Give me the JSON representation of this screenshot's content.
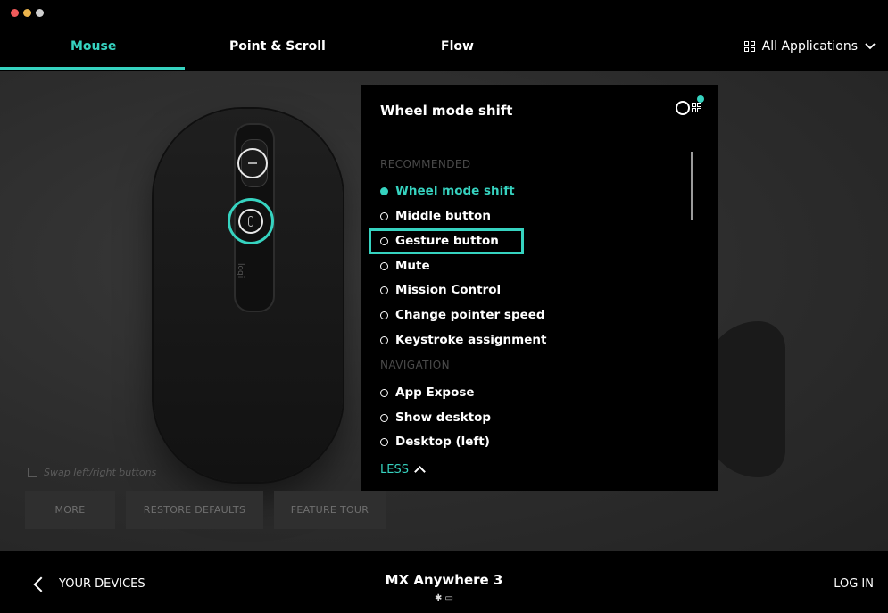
{
  "tabs": [
    {
      "label": "Mouse",
      "active": true
    },
    {
      "label": "Point & Scroll",
      "active": false
    },
    {
      "label": "Flow",
      "active": false
    }
  ],
  "app_selector": {
    "label": "All Applications",
    "icon": "grid-icon"
  },
  "colors": {
    "accent": "#36d3c0",
    "background": "#262626",
    "panel": "#000000"
  },
  "panel": {
    "title": "Wheel mode shift",
    "section_recommended": "RECOMMENDED",
    "recommended": [
      {
        "label": "Wheel mode shift",
        "selected": true
      },
      {
        "label": "Middle button",
        "selected": false
      },
      {
        "label": "Gesture button",
        "selected": false,
        "highlighted": true
      },
      {
        "label": "Mute",
        "selected": false
      },
      {
        "label": "Mission Control",
        "selected": false
      },
      {
        "label": "Change pointer speed",
        "selected": false
      },
      {
        "label": "Keystroke assignment",
        "selected": false
      }
    ],
    "section_navigation": "NAVIGATION",
    "navigation": [
      {
        "label": "App Expose",
        "selected": false
      },
      {
        "label": "Show desktop",
        "selected": false
      },
      {
        "label": "Desktop (left)",
        "selected": false
      }
    ],
    "less_label": "LESS"
  },
  "mouse_logo": "logi",
  "swap_label": "Swap left/right buttons",
  "buttons": {
    "more": "MORE",
    "restore": "RESTORE DEFAULTS",
    "tour": "FEATURE TOUR"
  },
  "footer": {
    "back_label": "YOUR DEVICES",
    "device_name": "MX Anywhere 3",
    "device_status": "✱ ▭",
    "login_label": "LOG IN"
  }
}
